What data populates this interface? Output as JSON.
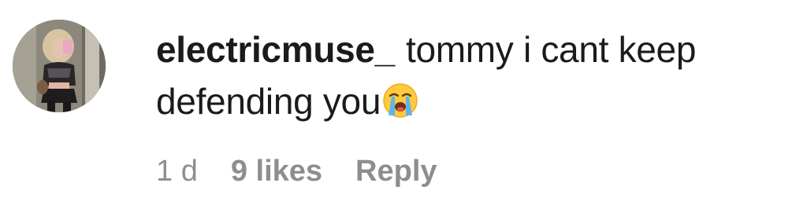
{
  "comment": {
    "username": "electricmuse_",
    "text": "tommy i cant keep defending you",
    "emoji_icon": "loudly-crying-face-icon",
    "time": "1 d",
    "likes": "9 likes",
    "reply_label": "Reply"
  },
  "colors": {
    "text": "#1b1b1b",
    "meta": "#8e8e8e",
    "background": "#ffffff"
  }
}
